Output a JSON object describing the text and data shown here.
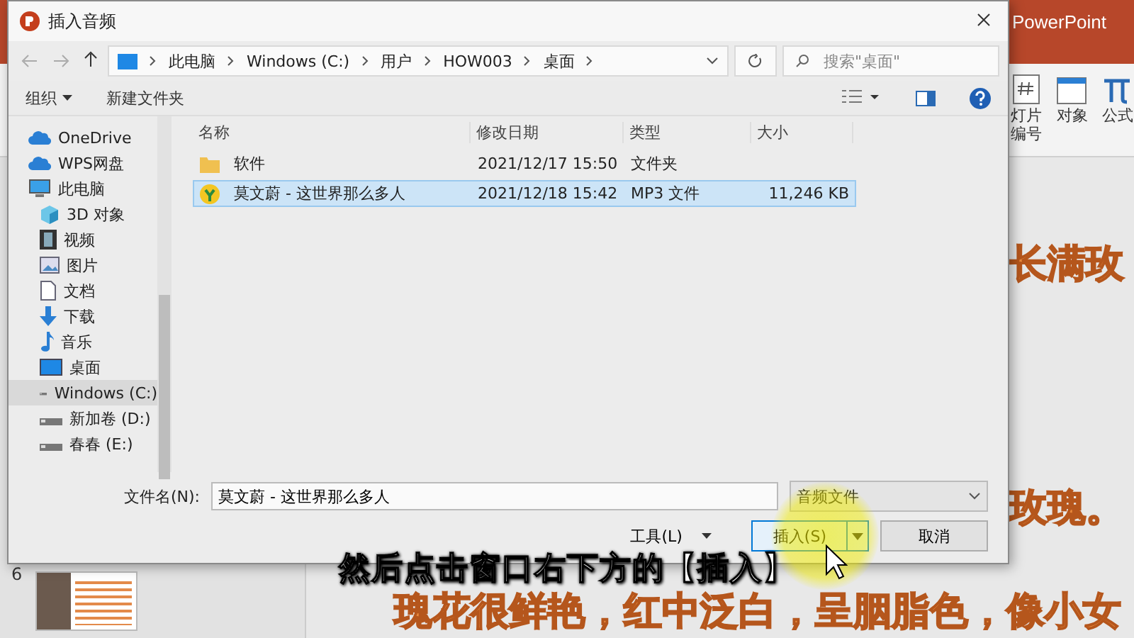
{
  "powerpoint": {
    "title": "PowerPoint",
    "ribbon": [
      {
        "label": "灯片编号",
        "kind": "slide-number"
      },
      {
        "label": "对象",
        "kind": "object"
      },
      {
        "label": "公式",
        "kind": "equation"
      }
    ],
    "slide_number": "6",
    "slide_texts": [
      "长满玫",
      "玫瑰。",
      "瑰花很鲜艳，红中泛白，呈胭脂色，像小女"
    ]
  },
  "dialog": {
    "title": "插入音频",
    "breadcrumb": [
      "此电脑",
      "Windows (C:)",
      "用户",
      "HOW003",
      "桌面"
    ],
    "search": {
      "placeholder": "搜索\"桌面\""
    },
    "toolbar": {
      "organize": "组织",
      "new_folder": "新建文件夹"
    },
    "nav_tree": [
      {
        "label": "OneDrive",
        "kind": "cloud",
        "selected": false
      },
      {
        "label": "WPS网盘",
        "kind": "cloud",
        "selected": false
      },
      {
        "label": "此电脑",
        "kind": "pc",
        "selected": false,
        "children": [
          {
            "label": "3D 对象",
            "kind": "cube",
            "selected": false
          },
          {
            "label": "视频",
            "kind": "video",
            "selected": false
          },
          {
            "label": "图片",
            "kind": "picture",
            "selected": false
          },
          {
            "label": "文档",
            "kind": "document",
            "selected": false
          },
          {
            "label": "下载",
            "kind": "download",
            "selected": false
          },
          {
            "label": "音乐",
            "kind": "music",
            "selected": false
          },
          {
            "label": "桌面",
            "kind": "desktop",
            "selected": false
          },
          {
            "label": "Windows (C:)",
            "kind": "drive",
            "selected": true
          },
          {
            "label": "新加卷 (D:)",
            "kind": "drive",
            "selected": false
          },
          {
            "label": "春春 (E:)",
            "kind": "drive",
            "selected": false
          }
        ]
      }
    ],
    "columns": [
      "名称",
      "修改日期",
      "类型",
      "大小"
    ],
    "files": [
      {
        "name": "软件",
        "modified": "2021/12/17 15:50",
        "type": "文件夹",
        "kind": "folder",
        "selected": false
      },
      {
        "name": "莫文蔚 - 这世界那么多人",
        "modified": "2021/12/18 15:42",
        "type": "MP3 文件",
        "size": "11,246 KB",
        "kind": "audio",
        "selected": true
      }
    ],
    "filename_label": "文件名(N):",
    "filename": {
      "value": "莫文蔚 - 这世界那么多人"
    },
    "filetype": "音频文件",
    "tools": "工具(L)",
    "insert": "插入(S)",
    "cancel": "取消"
  },
  "caption": "然后点击窗口右下方的【插入】"
}
